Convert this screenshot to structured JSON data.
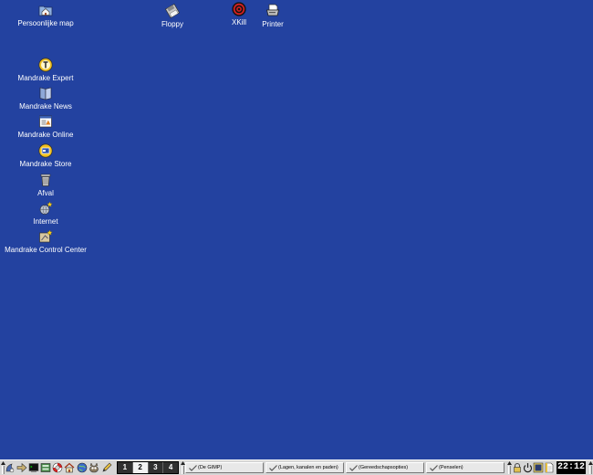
{
  "colors": {
    "desktop_background": "#2342a0",
    "label_text": "#ffffff",
    "panel_background": "#d6d6d6",
    "pager_background": "#303030",
    "pager_active_background": "#f2f2f2",
    "clock_background": "#000000",
    "clock_text": "#ffffff"
  },
  "desktop": {
    "icons": [
      {
        "label": "Persoonlijke map",
        "icon": "home-folder-icon"
      },
      {
        "label": "Floppy",
        "icon": "floppy-icon"
      },
      {
        "label": "XKill",
        "icon": "xkill-target-icon"
      },
      {
        "label": "Printer",
        "icon": "printer-icon"
      },
      {
        "label": "Mandrake Expert",
        "icon": "mandrake-expert-icon"
      },
      {
        "label": "Mandrake News",
        "icon": "mandrake-news-icon"
      },
      {
        "label": "Mandrake Online",
        "icon": "mandrake-online-icon"
      },
      {
        "label": "Mandrake Store",
        "icon": "mandrake-store-icon"
      },
      {
        "label": "Afval",
        "icon": "trash-icon"
      },
      {
        "label": "Internet",
        "icon": "internet-icon"
      },
      {
        "label": "Mandrake Control Center",
        "icon": "control-center-icon"
      }
    ]
  },
  "panel": {
    "launchers": [
      "main-menu-icon",
      "arrow-icon",
      "terminal-icon",
      "file-manager-icon",
      "help-icon",
      "home-icon",
      "web-browser-icon",
      "gimp-icon",
      "editor-icon"
    ],
    "pager": {
      "workspaces": [
        "1",
        "2",
        "3",
        "4"
      ],
      "active_index": 1
    },
    "tasks": [
      {
        "label": "(De GIMP)",
        "icon": "gimp-window-icon"
      },
      {
        "label": "(Lagen, kanalen en paden)",
        "icon": "gimp-window-icon"
      },
      {
        "label": "(Gereedschapsopties)",
        "icon": "gimp-window-icon"
      },
      {
        "label": "(Penselen)",
        "icon": "gimp-window-icon"
      }
    ],
    "tray": [
      "lock-screen-icon",
      "logout-icon",
      "monitor-icon",
      "notepad-icon"
    ],
    "clock": "22:12"
  }
}
